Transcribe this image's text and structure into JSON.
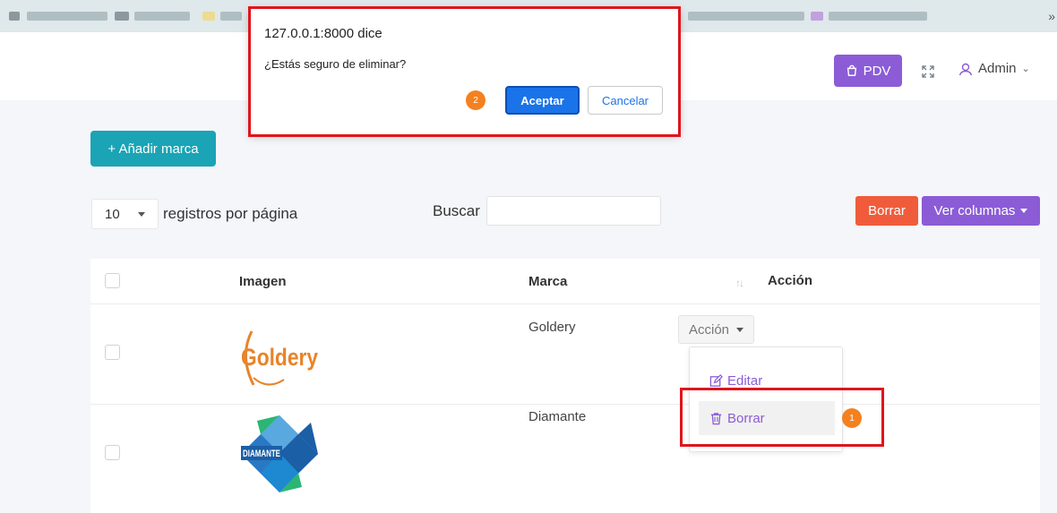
{
  "header": {
    "pdv_label": "PDV",
    "user_label": "Admin"
  },
  "toolbar": {
    "add_brand_label": "+ Añadir marca",
    "page_length_value": "10",
    "page_length_label": "registros por página",
    "search_label": "Buscar",
    "search_value": "",
    "delete_label": "Borrar",
    "columns_label": "Ver columnas"
  },
  "table": {
    "columns": [
      "Imagen",
      "Marca",
      "Acción"
    ],
    "rows": [
      {
        "brand": "Goldery",
        "logo_text": "Goldery",
        "action_label": "Acción"
      },
      {
        "brand": "Diamante",
        "logo_text": "DIAMANTE"
      }
    ]
  },
  "action_menu": {
    "items": [
      {
        "label": "Editar",
        "icon": "edit-icon"
      },
      {
        "label": "Borrar",
        "icon": "trash-icon"
      }
    ]
  },
  "dialog": {
    "title": "127.0.0.1:8000 dice",
    "message": "¿Estás seguro de eliminar?",
    "ok_label": "Aceptar",
    "cancel_label": "Cancelar"
  },
  "annotations": {
    "step1": "1",
    "step2": "2"
  },
  "colors": {
    "accent_purple": "#8b5cd6",
    "teal": "#1aa4b5",
    "danger": "#f05c3b",
    "highlight_red": "#e0151c",
    "step_orange": "#f48120",
    "dialog_blue": "#1a73e8"
  }
}
